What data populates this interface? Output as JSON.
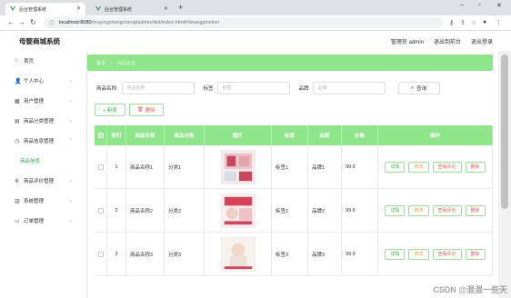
{
  "browser": {
    "tabs": [
      {
        "label": "后台管理系统",
        "active": true
      },
      {
        "label": "后台管理系统",
        "active": false
      }
    ],
    "url_host": "localhost:8080",
    "url_path": "/muyingshangcheng/admin/dist/index.html#/shangpinxinxi"
  },
  "header": {
    "title": "母婴商城系统",
    "user": "管理员 admin",
    "to_front": "退出到前台",
    "logout": "退出登录"
  },
  "sidebar": {
    "items": [
      {
        "label": "首页",
        "icon": "home-icon"
      },
      {
        "label": "个人中心",
        "icon": "user-icon"
      },
      {
        "label": "用户管理",
        "icon": "grid-icon"
      },
      {
        "label": "商品分类管理",
        "icon": "table-icon"
      },
      {
        "label": "商品信息管理",
        "icon": "info-icon"
      },
      {
        "label": "商品信息",
        "icon": ""
      },
      {
        "label": "商品评价管理",
        "icon": "star-icon"
      },
      {
        "label": "系统管理",
        "icon": "system-icon"
      },
      {
        "label": "订单管理",
        "icon": "order-icon"
      }
    ]
  },
  "breadcrumb": {
    "home": "首页",
    "sep": "→",
    "current": "商品信息"
  },
  "search": {
    "name_label": "商品名称:",
    "name_placeholder": "商品名称",
    "tag_label": "标签",
    "tag_placeholder": "标签",
    "brand_label": "品牌",
    "brand_placeholder": "品牌",
    "query_label": "查询"
  },
  "actions": {
    "add": "+ 新增",
    "delete": "删除"
  },
  "table": {
    "headers": [
      "",
      "索引",
      "商品名称",
      "商品分类",
      "图片",
      "标签",
      "品牌",
      "价格",
      "操作"
    ],
    "rows": [
      {
        "index": "1",
        "name": "商品名称1",
        "category": "分类1",
        "tag": "标签1",
        "brand": "品牌1",
        "price": "99.9"
      },
      {
        "index": "2",
        "name": "商品名称2",
        "category": "分类2",
        "tag": "标签2",
        "brand": "品牌2",
        "price": "99.9"
      },
      {
        "index": "3",
        "name": "商品名称3",
        "category": "分类3",
        "tag": "标签3",
        "brand": "品牌3",
        "price": "99.9"
      }
    ],
    "ops": {
      "detail": "详情",
      "edit": "修改",
      "reviews": "查看评论",
      "delete": "删除"
    }
  },
  "watermark": "CSDN @混混一些天",
  "colors": {
    "accent": "#8ee58a",
    "primary_text": "#3bb34a",
    "danger": "#e05a5a",
    "warn": "#e6a23c"
  }
}
